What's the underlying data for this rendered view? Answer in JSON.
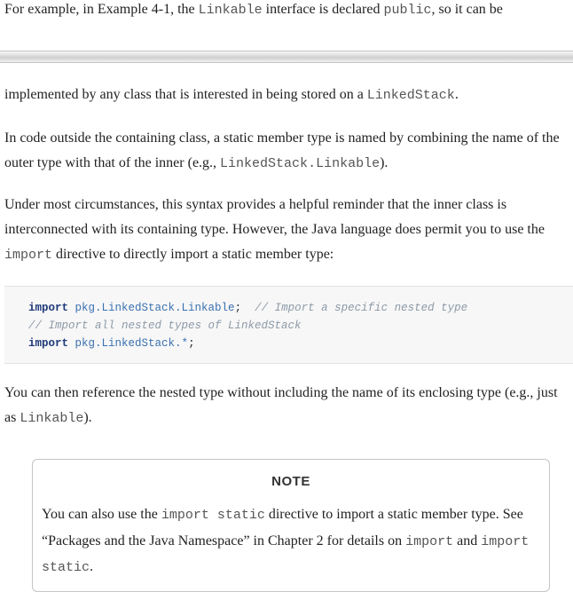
{
  "top": {
    "prefix": "For example, in ",
    "example_ref": "Example 4-1",
    "mid1": ", the ",
    "code1": "Linkable",
    "mid2": " interface is declared ",
    "code2": "public",
    "suffix": ", so it can be"
  },
  "p1": {
    "text": "implemented by any class that is interested in being stored on a ",
    "code": "LinkedStack",
    "end": "."
  },
  "p2": {
    "text": "In code outside the containing class, a static member type is named by combining the name of the outer type with that of the inner (e.g., ",
    "code": "LinkedStack.Linkable",
    "end": ")."
  },
  "p3": {
    "text": "Under most circumstances, this syntax provides a helpful reminder that the inner class is interconnected with its containing type. However, the Java language does permit you to use the ",
    "code": "import",
    "end": " directive to directly import a static member type:"
  },
  "code": {
    "line1": {
      "kw": "import",
      "pkg": "pkg.LinkedStack.Linkable",
      "semi": ";",
      "comment": "// Import a specific nested type"
    },
    "line2": {
      "comment": "// Import all nested types of LinkedStack"
    },
    "line3": {
      "kw": "import",
      "pkg": "pkg.LinkedStack.*",
      "semi": ";"
    }
  },
  "p4": {
    "text": "You can then reference the nested type without including the name of its enclosing type (e.g., just as ",
    "code": "Linkable",
    "end": ")."
  },
  "note": {
    "title": "NOTE",
    "t1": "You can also use the ",
    "c1": "import static",
    "t2": " directive to import a static member type. See “Packages and the Java Namespace” in ",
    "link": "Chapter 2",
    "t3": " for details on ",
    "c2": "import",
    "t4": " and ",
    "c3": "import static",
    "t5": "."
  }
}
